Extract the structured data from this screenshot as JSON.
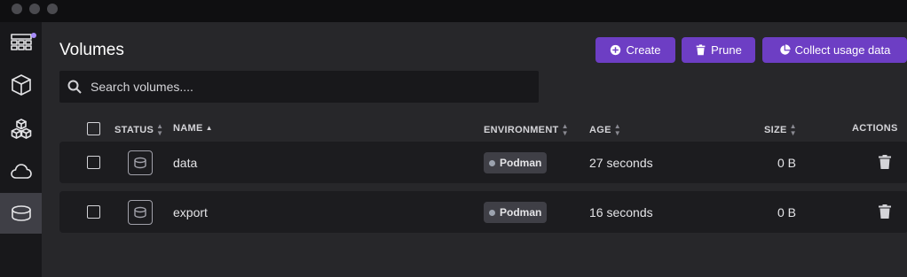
{
  "header": {
    "title": "Volumes",
    "buttons": {
      "create": "Create",
      "prune": "Prune",
      "collect": "Collect usage data"
    }
  },
  "search": {
    "placeholder": "Search volumes...."
  },
  "table": {
    "columns": {
      "status": "STATUS",
      "name": "NAME",
      "environment": "ENVIRONMENT",
      "age": "AGE",
      "size": "SIZE",
      "actions": "ACTIONS"
    },
    "rows": [
      {
        "name": "data",
        "environment": "Podman",
        "age": "27 seconds",
        "size": "0 B"
      },
      {
        "name": "export",
        "environment": "Podman",
        "age": "16 seconds",
        "size": "0 B"
      }
    ]
  },
  "sidebar": {
    "items": [
      {
        "icon": "dashboard-icon"
      },
      {
        "icon": "containers-icon"
      },
      {
        "icon": "images-icon"
      },
      {
        "icon": "pods-icon"
      },
      {
        "icon": "volumes-icon",
        "active": true
      }
    ]
  },
  "colors": {
    "accent": "#6d3ec4",
    "notification": "#a78bfa"
  }
}
